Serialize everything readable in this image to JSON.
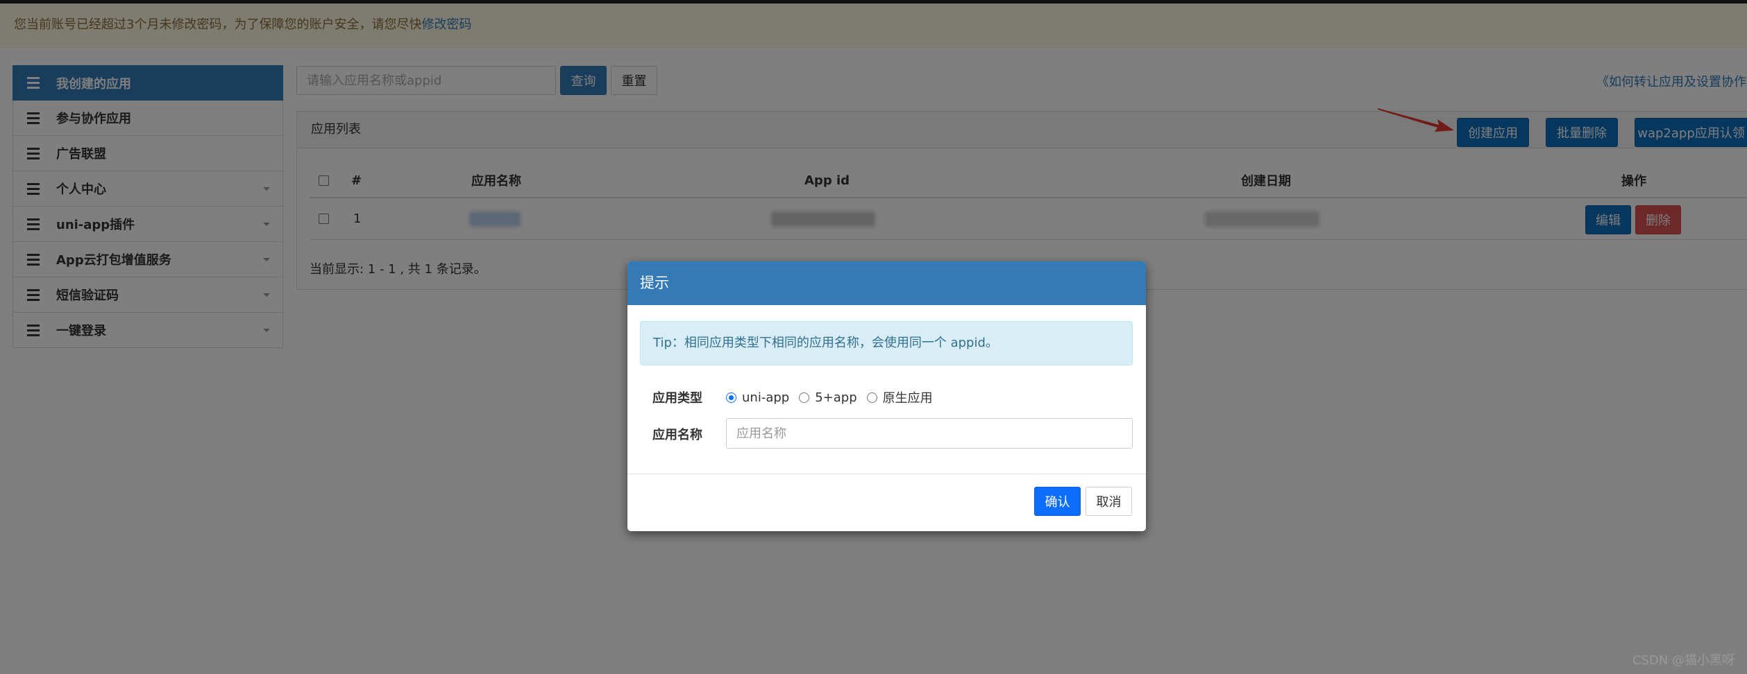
{
  "notice": {
    "text": "您当前账号已经超过3个月未修改密码，为了保障您的账户安全，请您尽快",
    "link": "修改密码"
  },
  "sidebar": {
    "items": [
      {
        "label": "我创建的应用",
        "active": true,
        "has_caret": false
      },
      {
        "label": "参与协作应用",
        "active": false,
        "has_caret": false
      },
      {
        "label": "广告联盟",
        "active": false,
        "has_caret": false
      },
      {
        "label": "个人中心",
        "active": false,
        "has_caret": true
      },
      {
        "label": "uni-app插件",
        "active": false,
        "has_caret": true
      },
      {
        "label": "App云打包增值服务",
        "active": false,
        "has_caret": true
      },
      {
        "label": "短信验证码",
        "active": false,
        "has_caret": true
      },
      {
        "label": "一键登录",
        "active": false,
        "has_caret": true
      }
    ]
  },
  "search": {
    "placeholder": "请输入应用名称或appid",
    "query_label": "查询",
    "reset_label": "重置"
  },
  "help_link": "《如何转让应用及设置协作者",
  "actions": {
    "create_label": "创建应用",
    "batch_delete_label": "批量删除",
    "wap2app_label": "wap2app应用认领"
  },
  "panel": {
    "title": "应用列表",
    "columns": [
      "#",
      "应用名称",
      "App id",
      "创建日期",
      "操作"
    ],
    "rows": [
      {
        "index": "1",
        "edit_label": "编辑",
        "delete_label": "删除"
      }
    ],
    "footer": "当前显示: 1 - 1 , 共 1 条记录。"
  },
  "modal": {
    "title": "提示",
    "tip": "Tip：相同应用类型下相同的应用名称，会使用同一个 appid。",
    "type_label": "应用类型",
    "type_options": [
      "uni-app",
      "5+app",
      "原生应用"
    ],
    "type_selected": "uni-app",
    "name_label": "应用名称",
    "name_placeholder": "应用名称",
    "confirm_label": "确认",
    "cancel_label": "取消"
  },
  "watermark": "CSDN @猫小黑呀",
  "colors": {
    "primary": "#337ab7",
    "action_blue": "#0d6ebd",
    "danger": "#d9534f",
    "notice_bg": "#fcf8e3",
    "arrow": "#e53935"
  }
}
